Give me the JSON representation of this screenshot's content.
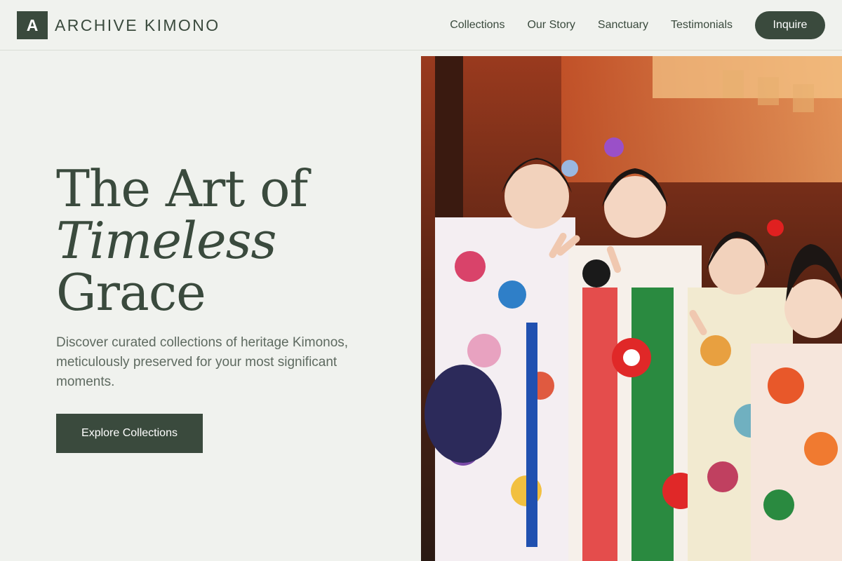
{
  "brand": {
    "mark": "A",
    "name": "ARCHIVE KIMONO"
  },
  "nav": {
    "links": [
      "Collections",
      "Our Story",
      "Sanctuary",
      "Testimonials"
    ],
    "cta": "Inquire"
  },
  "hero": {
    "title_line1": "The Art of",
    "title_line2": "Timeless",
    "title_line3": "Grace",
    "subtitle": "Discover curated collections of heritage Kimonos, meticulously preserved for your most significant moments.",
    "cta": "Explore Collections",
    "photo_icon": "photo-kimono-group"
  },
  "colors": {
    "background": "#f0f2ee",
    "primary": "#3a4a3d",
    "text_muted": "#5e6a60"
  }
}
